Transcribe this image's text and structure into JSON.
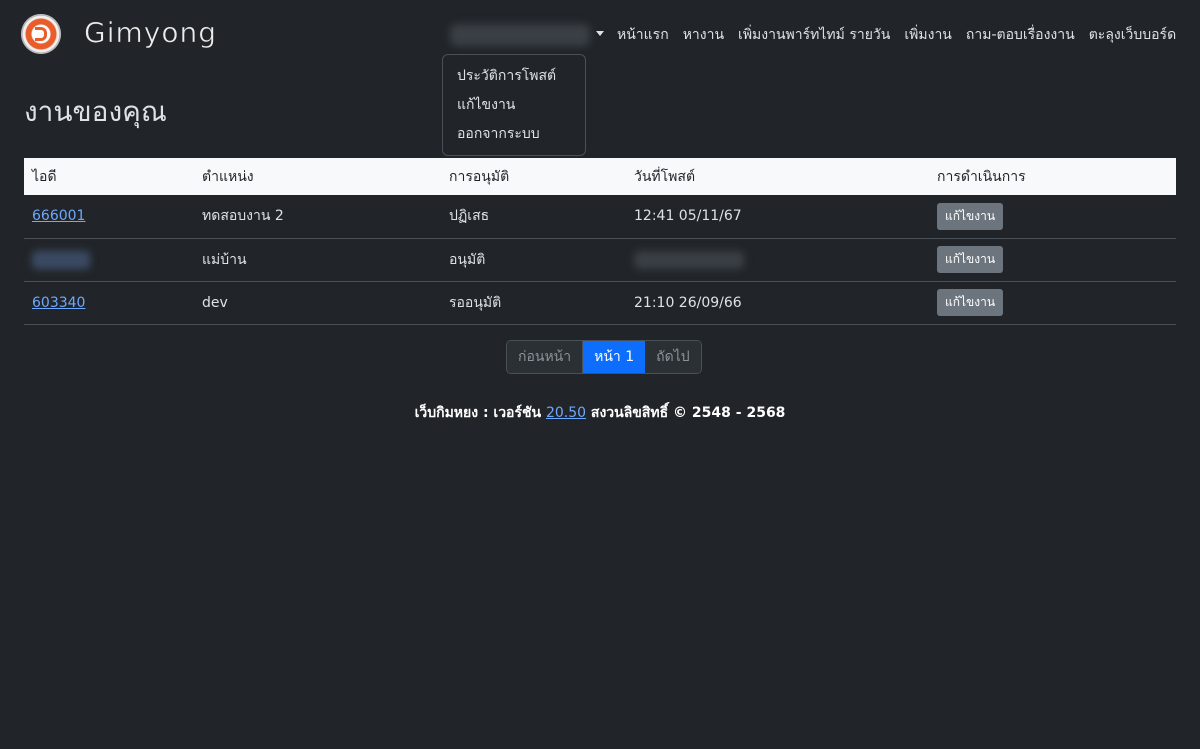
{
  "brand": {
    "name": "Gimyong",
    "logo_icon": "gimyong-logo-icon"
  },
  "nav": {
    "links": [
      "หน้าแรก",
      "หางาน",
      "เพิ่มงานพาร์ทไทม์ รายวัน",
      "เพิ่มงาน",
      "ถาม-ตอบเรื่องงาน",
      "ตะลุงเว็บบอร์ด"
    ],
    "user_menu_icon": "caret-down-icon",
    "dropdown": [
      "ประวัติการโพสต์",
      "แก้ไขงาน",
      "ออกจากระบบ"
    ]
  },
  "page": {
    "title": "งานของคุณ"
  },
  "table": {
    "headers": [
      "ไอดี",
      "ตำแหน่ง",
      "การอนุมัติ",
      "วันที่โพสต์",
      "การดำเนินการ"
    ],
    "rows": [
      {
        "id": "666001",
        "position": "ทดสอบงาน 2",
        "approval": "ปฏิเสธ",
        "date": "12:41 05/11/67",
        "action": "แก้ไขงาน"
      },
      {
        "id": "",
        "position": "แม่บ้าน",
        "approval": "อนุมัติ",
        "date": "",
        "action": "แก้ไขงาน"
      },
      {
        "id": "603340",
        "position": "dev",
        "approval": "รออนุมัติ",
        "date": "21:10 26/09/66",
        "action": "แก้ไขงาน"
      }
    ]
  },
  "pagination": {
    "prev": "ก่อนหน้า",
    "current": "หน้า 1",
    "next": "ถัดไป"
  },
  "footer": {
    "prefix": "เว็บกิมหยง : เวอร์ชัน",
    "version": "20.50",
    "suffix": "สงวนลิขสิทธิ์ © 2548 - 2568"
  },
  "colors": {
    "background": "#212529",
    "accent": "#0d6efd",
    "link": "#6ea8fe",
    "button": "#6c757d"
  }
}
